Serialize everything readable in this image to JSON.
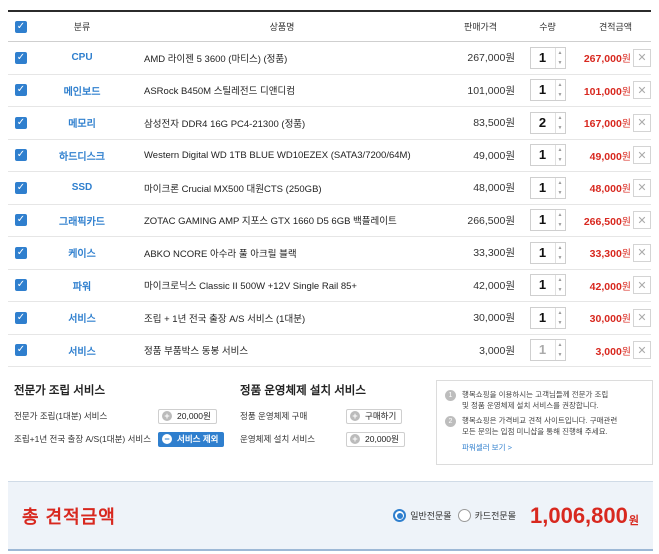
{
  "table": {
    "headers": {
      "category": "분류",
      "product": "상품명",
      "price": "판매가격",
      "qty": "수량",
      "total": "견적금액"
    },
    "rows": [
      {
        "category": "CPU",
        "name": "AMD 라이젠 5 3600 (마티스) (정품)",
        "price": "267,000원",
        "qty": "1",
        "total": "267,000",
        "won": "원",
        "checked": true
      },
      {
        "category": "메인보드",
        "name": "ASRock B450M 스틸레전드 디앤디컴",
        "price": "101,000원",
        "qty": "1",
        "total": "101,000",
        "won": "원",
        "checked": true
      },
      {
        "category": "메모리",
        "name": "삼성전자 DDR4 16G PC4-21300 (정품)",
        "price": "83,500원",
        "qty": "2",
        "total": "167,000",
        "won": "원",
        "checked": true
      },
      {
        "category": "하드디스크",
        "name": "Western Digital WD 1TB BLUE WD10EZEX (SATA3/7200/64M)",
        "price": "49,000원",
        "qty": "1",
        "total": "49,000",
        "won": "원",
        "checked": true
      },
      {
        "category": "SSD",
        "name": "마이크론 Crucial MX500 대원CTS (250GB)",
        "price": "48,000원",
        "qty": "1",
        "total": "48,000",
        "won": "원",
        "checked": true
      },
      {
        "category": "그래픽카드",
        "name": "ZOTAC GAMING AMP 지포스 GTX 1660 D5 6GB 백플레이트",
        "price": "266,500원",
        "qty": "1",
        "total": "266,500",
        "won": "원",
        "checked": true
      },
      {
        "category": "케이스",
        "name": "ABKO NCORE 아수라 풀 아크릴 블랙",
        "price": "33,300원",
        "qty": "1",
        "total": "33,300",
        "won": "원",
        "checked": true
      },
      {
        "category": "파워",
        "name": "마이크로닉스 Classic II 500W +12V Single Rail 85+",
        "price": "42,000원",
        "qty": "1",
        "total": "42,000",
        "won": "원",
        "checked": true
      },
      {
        "category": "서비스",
        "name": "조립 + 1년 전국 출장 A/S 서비스 (1대분)",
        "price": "30,000원",
        "qty": "1",
        "total": "30,000",
        "won": "원",
        "checked": true
      },
      {
        "category": "서비스",
        "name": "정품 부품박스 동봉 서비스",
        "price": "3,000원",
        "qty": "1",
        "total": "3,000",
        "won": "원",
        "checked": true
      }
    ]
  },
  "assembly": {
    "title": "전문가 조립 서비스",
    "line1_label": "전문가 조립(1대분) 서비스",
    "line1_button": "20,000원",
    "line2_label": "조립+1년 전국 출장 A/S(1대분) 서비스",
    "line2_button": "서비스 제외"
  },
  "os": {
    "title": "정품 운영체제 설치 서비스",
    "line1_label": "정품 운영체제 구매",
    "line1_button": "구매하기",
    "line2_label": "운영체제 설치 서비스",
    "line2_button": "20,000원"
  },
  "info": {
    "n1": "1",
    "text1a": "행복쇼핑을 이용하시는 고객님들께 전문가 조립",
    "text1b": "및 정품 운영체제 설치 서비스를 권장합니다.",
    "n2": "2",
    "text2a": "행복쇼핑은 가격비교 견적 사이트입니다. 구매관련",
    "text2b": "모든 문의는 입점 미니샵을 통해 진행해 주세요.",
    "link": "파워셀러 보기 >"
  },
  "total": {
    "title": "총 견적금액",
    "option1": "일반전문몰",
    "option2": "카드전문몰",
    "amount": "1,006,800",
    "won": "원"
  },
  "colors": {
    "accent": "#2f7fce",
    "price_red": "#d8281f"
  },
  "icons": {
    "check": "checkmark-icon",
    "delete": "close-icon",
    "spin": "spinner-arrows-icon"
  }
}
